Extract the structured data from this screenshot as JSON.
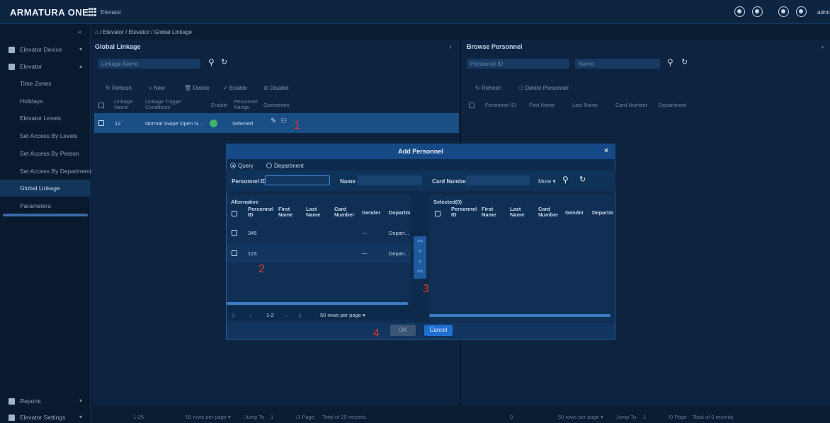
{
  "header": {
    "logo": "ARMATURA ONE",
    "app_name": "Elevator",
    "admin": "admin"
  },
  "breadcrumb": [
    "Elevator",
    "Elevator",
    "Global Linkage"
  ],
  "sidebar": {
    "items": [
      {
        "label": "Elevator Device",
        "icon": "elevator-device-icon"
      },
      {
        "label": "Elevator",
        "icon": "elevator-icon"
      },
      {
        "label": "Time Zones"
      },
      {
        "label": "Holidays"
      },
      {
        "label": "Elevator Levels"
      },
      {
        "label": "Set Access By Levels"
      },
      {
        "label": "Set Access By Person"
      },
      {
        "label": "Set Access By Department"
      },
      {
        "label": "Global Linkage"
      },
      {
        "label": "Parameters"
      }
    ],
    "bottom": [
      {
        "label": "Reports",
        "icon": "reports-icon"
      },
      {
        "label": "Elevator Settings",
        "icon": "settings-icon"
      }
    ]
  },
  "linkage_panel": {
    "title": "Global Linkage",
    "search_label": "Linkage Name",
    "toolbar": {
      "refresh": "Refresh",
      "new": "New",
      "delete": "Delete",
      "enable": "Enable",
      "disable": "Disable"
    },
    "columns": [
      "Linkage Name",
      "Linkage Trigger Conditions",
      "Enable",
      "Personnel Range",
      "Operations"
    ],
    "rows": [
      {
        "name": "12",
        "trigger": "Normal Swipe Open N...",
        "range": "Selected"
      }
    ],
    "footer": {
      "range": "1-25",
      "per_page": "50 rows per page",
      "jump": "Jump To",
      "page_input": "1",
      "page": "/1 Page",
      "total": "Total of 25 records"
    }
  },
  "browse_panel": {
    "title": "Browse Personnel",
    "search_id_label": "Personnel ID",
    "search_name_label": "Name",
    "toolbar": {
      "refresh": "Refresh",
      "delete": "Delete Personnel"
    },
    "columns": [
      "Personnel ID",
      "First Name",
      "Last Name",
      "Card Number",
      "Department"
    ],
    "footer": {
      "range": "0",
      "per_page": "50 rows per page",
      "jump": "Jump To",
      "page_input": "1",
      "page": "/0 Page",
      "total": "Total of 0 records"
    }
  },
  "modal": {
    "title": "Add Personnel",
    "radios": [
      "Query",
      "Department"
    ],
    "filters": {
      "personnel_id": "Personnel ID",
      "name": "Name",
      "card_number": "Card Number",
      "more": "More"
    },
    "alternative": {
      "title": "Alternative",
      "columns": [
        "Personnel ID",
        "First Name",
        "Last Name",
        "Card Number",
        "Gender",
        "Departme"
      ],
      "rows": [
        {
          "id": "345",
          "gender": "—",
          "dept": "Depart..."
        },
        {
          "id": "123",
          "gender": "—",
          "dept": "Depart..."
        }
      ],
      "pager": {
        "range": "1-2",
        "per_page": "50 rows per page"
      }
    },
    "selected": {
      "title": "Selected(0)",
      "columns": [
        "Personnel ID",
        "First Name",
        "Last Name",
        "Card Number",
        "Gender",
        "Departme"
      ]
    },
    "transfer": [
      ">>",
      ">",
      "<",
      "<<"
    ],
    "ok": "OK",
    "cancel": "Cancel"
  },
  "annotations": [
    "1",
    "2",
    "3",
    "4"
  ],
  "colors": {
    "accent": "#1f6fd0",
    "header": "#164a86",
    "success": "#3fb46a",
    "annotation": "#e53a2a"
  }
}
